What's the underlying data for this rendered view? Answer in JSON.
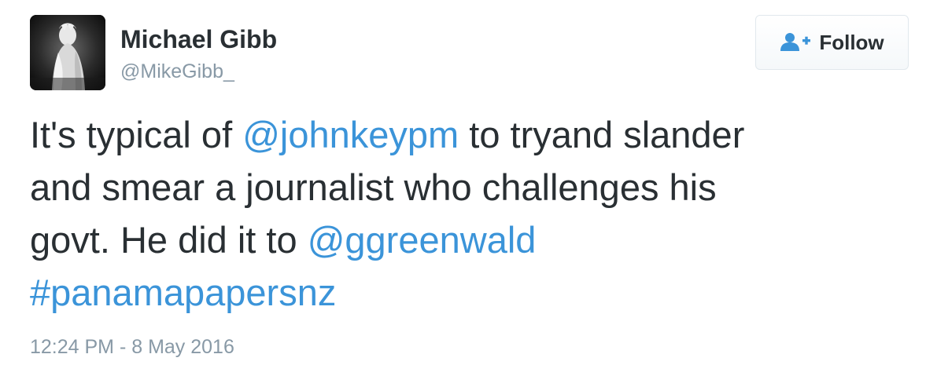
{
  "author": {
    "display_name": "Michael Gibb",
    "handle": "@MikeGibb_",
    "avatar_icon": "profile-photo-avatar"
  },
  "follow_button": {
    "label": "Follow",
    "icon": "follow-user-plus-icon",
    "icon_color": "#3b94d9"
  },
  "tweet": {
    "line1": {
      "text_before": "It's typical of ",
      "mention": "@johnkeypm",
      "text_after": " to tryand slander"
    },
    "line2": "and smear a journalist who challenges his",
    "line3": {
      "text_before": "govt. He did it to ",
      "mention": "@ggreenwald"
    },
    "hashtag": "#panamapapersnz"
  },
  "timestamp": "12:24 PM - 8 May 2016",
  "colors": {
    "link": "#3b94d9",
    "text": "#292f33",
    "muted": "#8899a6"
  }
}
